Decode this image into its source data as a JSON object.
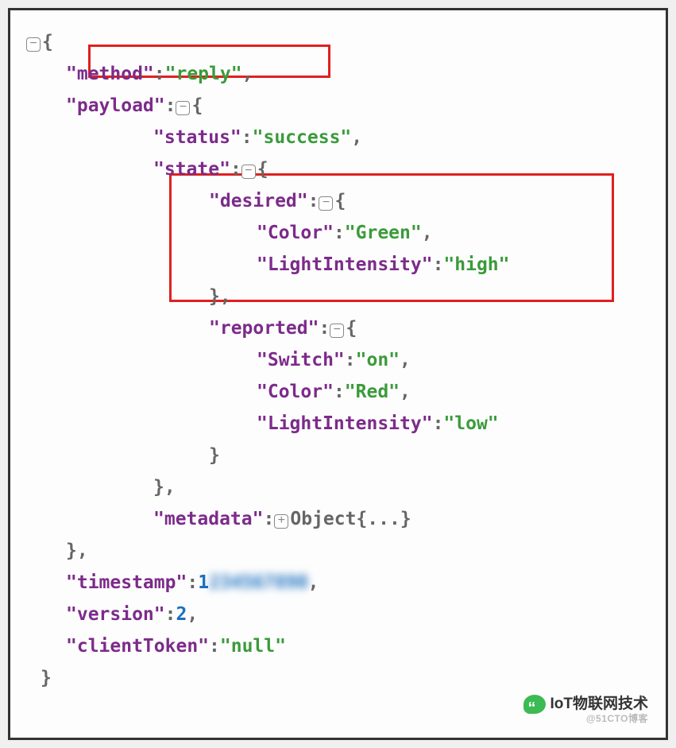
{
  "json": {
    "method_key": "\"method\"",
    "method_val": "\"reply\"",
    "payload_key": "\"payload\"",
    "status_key": "\"status\"",
    "status_val": "\"success\"",
    "state_key": "\"state\"",
    "desired_key": "\"desired\"",
    "desired_color_key": "\"Color\"",
    "desired_color_val": "\"Green\"",
    "desired_li_key": "\"LightIntensity\"",
    "desired_li_val": "\"high\"",
    "reported_key": "\"reported\"",
    "reported_switch_key": "\"Switch\"",
    "reported_switch_val": "\"on\"",
    "reported_color_key": "\"Color\"",
    "reported_color_val": "\"Red\"",
    "reported_li_key": "\"LightIntensity\"",
    "reported_li_val": "\"low\"",
    "metadata_key": "\"metadata\"",
    "metadata_val": "Object{...}",
    "timestamp_key": "\"timestamp\"",
    "timestamp_first": "1",
    "timestamp_blur": "234567890",
    "version_key": "\"version\"",
    "version_val": "2",
    "clientToken_key": "\"clientToken\"",
    "clientToken_val": "\"null\""
  },
  "glyph": {
    "minus": "⊟",
    "plus": "⊞"
  },
  "watermark": {
    "main": "IoT物联网技术",
    "sub": "@51CTO博客"
  }
}
